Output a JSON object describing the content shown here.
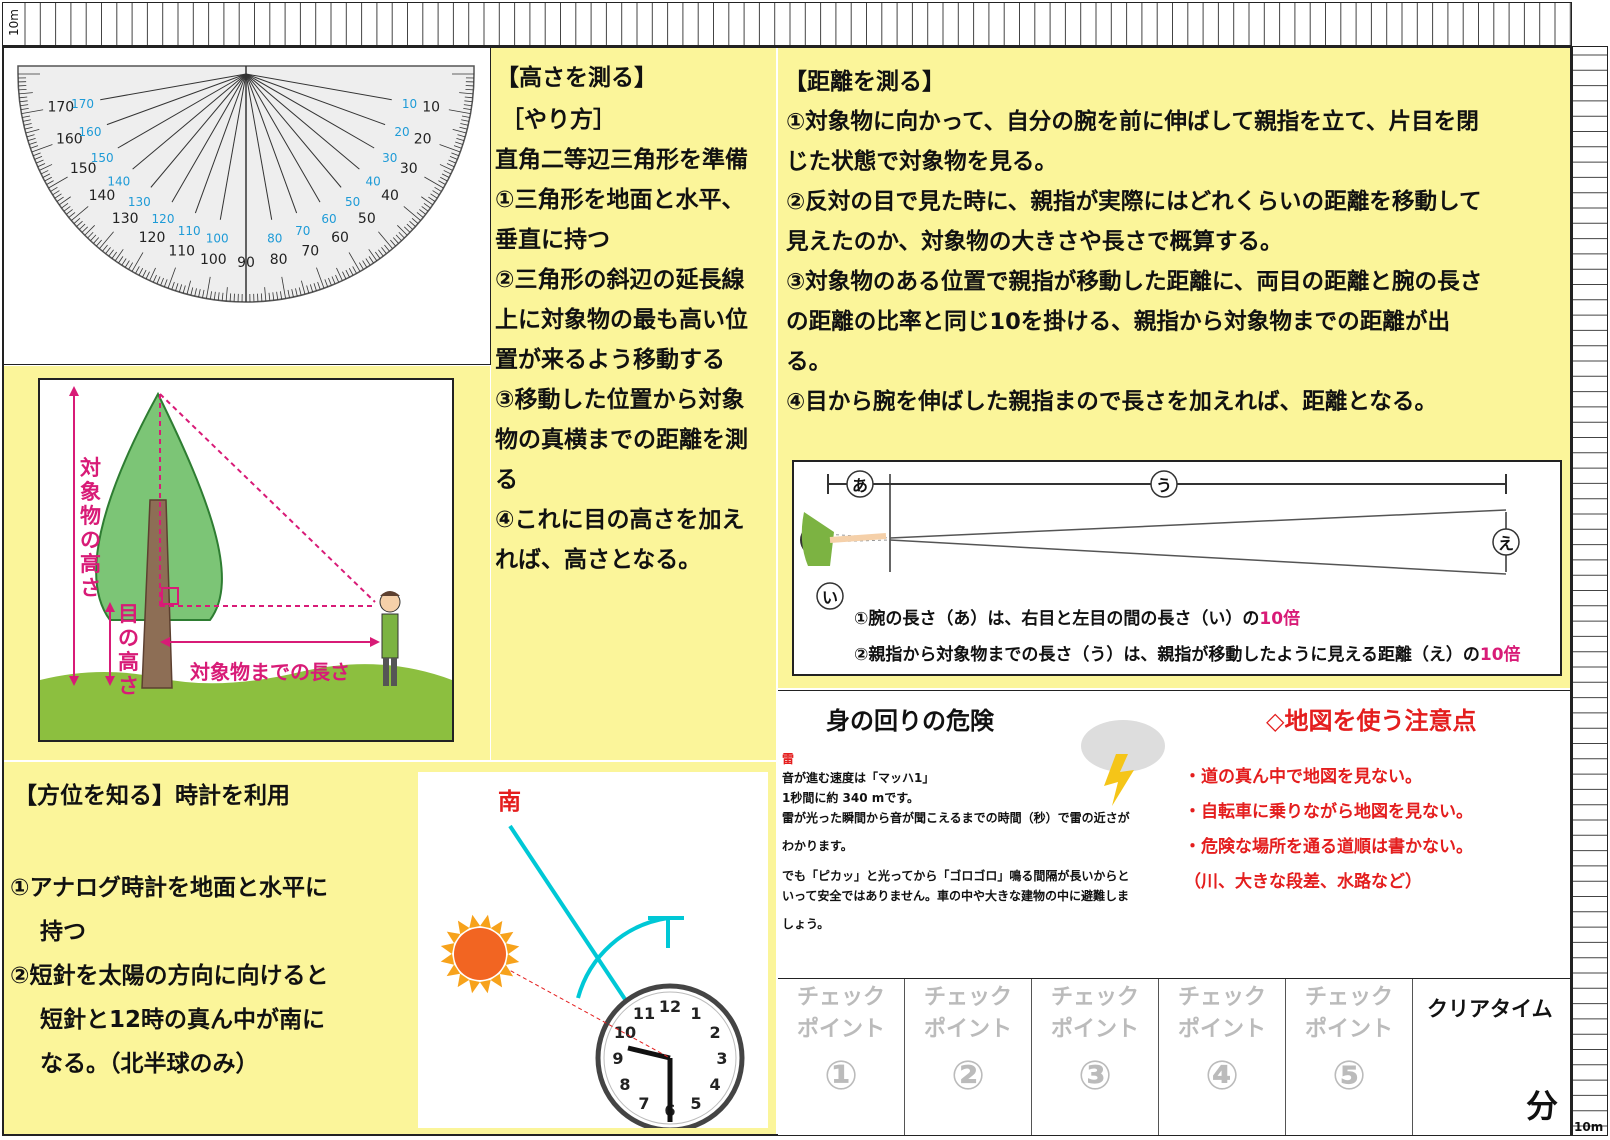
{
  "ruler": {
    "label_top": "10m",
    "label_bottom": "10m"
  },
  "height": {
    "title": "【高さを測る】",
    "method": "［やり方］",
    "steps": [
      "直角二等辺三角形を準備",
      "①三角形を地面と水平、",
      "垂直に持つ",
      "②三角形の斜辺の延長線",
      "上に対象物の最も高い位",
      "置が来るよう移動する",
      "③移動した位置から対象",
      "物の真横までの距離を測",
      "る",
      "④これに目の高さを加え",
      "れば、高さとなる。"
    ],
    "diagram": {
      "object_height": "対象物の高さ",
      "eye_height": "目の高さ",
      "distance": "対象物までの長さ"
    }
  },
  "distance": {
    "title": "【距離を測る】",
    "lines": [
      "①対象物に向かって、自分の腕を前に伸ばして親指を立て、片目を閉",
      "じた状態で対象物を見る。",
      "②反対の目で見た時に、親指が実際にはどれくらいの距離を移動して",
      "見えたのか、対象物の大きさや長さで概算する。",
      "③対象物のある位置で親指が移動した距離に、両目の距離と腕の長さ",
      "の距離の比率と同じ10を掛ける、親指から対象物までの距離が出",
      "る。",
      "④目から腕を伸ばした親指まので長さを加えれば、距離となる。"
    ],
    "diagram": {
      "a": "あ",
      "i": "い",
      "u": "う",
      "e": "え",
      "note1_text": "①腕の長さ（あ）は、右目と左目の間の長さ（い）の",
      "note1_ratio": "10倍",
      "note2_text": "②親指から対象物までの長さ（う）は、親指が移動したように見える距離（え）の",
      "note2_ratio": "10倍"
    }
  },
  "direction": {
    "title": "【方位を知る】時計を利用",
    "steps": [
      "①アナログ時計を地面と水平に",
      "持つ",
      "②短針を太陽の方向に向けると",
      "短針と12時の真ん中が南に",
      "なる。（北半球のみ）"
    ],
    "south": "南",
    "clock_numbers": [
      "12",
      "1",
      "2",
      "3",
      "4",
      "5",
      "6",
      "7",
      "8",
      "9",
      "10",
      "11"
    ]
  },
  "danger": {
    "title": "身の回りの危険",
    "thunder_title": "雷",
    "thunder_lines": [
      "音が進む速度は「マッハ1」",
      "1秒間に約 340 mです。",
      "雷が光った瞬間から音が聞こえるまでの時間（秒）で雷の近さが",
      "わかります。",
      "でも「ピカッ」と光ってから「ゴロゴロ」鳴る間隔が長いからと",
      "いって安全ではありません。車の中や大きな建物の中に避難しま",
      "しょう。"
    ]
  },
  "map": {
    "title": "◇地図を使う注意点",
    "items": [
      "・道の真ん中で地図を見ない。",
      "・自転車に乗りながら地図を見ない。",
      "・危険な場所を通る道順は書かない。",
      "（川、大きな段差、水路など）"
    ]
  },
  "checkpoints": [
    {
      "label1": "チェック",
      "label2": "ポイント",
      "num": "①"
    },
    {
      "label1": "チェック",
      "label2": "ポイント",
      "num": "②"
    },
    {
      "label1": "チェック",
      "label2": "ポイント",
      "num": "③"
    },
    {
      "label1": "チェック",
      "label2": "ポイント",
      "num": "④"
    },
    {
      "label1": "チェック",
      "label2": "ポイント",
      "num": "⑤"
    }
  ],
  "clear_time": {
    "label": "クリアタイム",
    "unit": "分"
  },
  "protractor": {
    "outer": [
      "10",
      "20",
      "30",
      "40",
      "50",
      "60",
      "70",
      "80",
      "90",
      "100",
      "110",
      "120",
      "130",
      "140",
      "150",
      "160",
      "170"
    ],
    "inner": [
      "170",
      "160",
      "150",
      "140",
      "130",
      "120",
      "110",
      "100",
      "80",
      "70",
      "60",
      "50",
      "40",
      "30",
      "20",
      "10"
    ]
  },
  "colors": {
    "yellow": "#fbf59a",
    "red": "#e41e1e",
    "magenta": "#d81b77",
    "cyan": "#00c8d6"
  }
}
